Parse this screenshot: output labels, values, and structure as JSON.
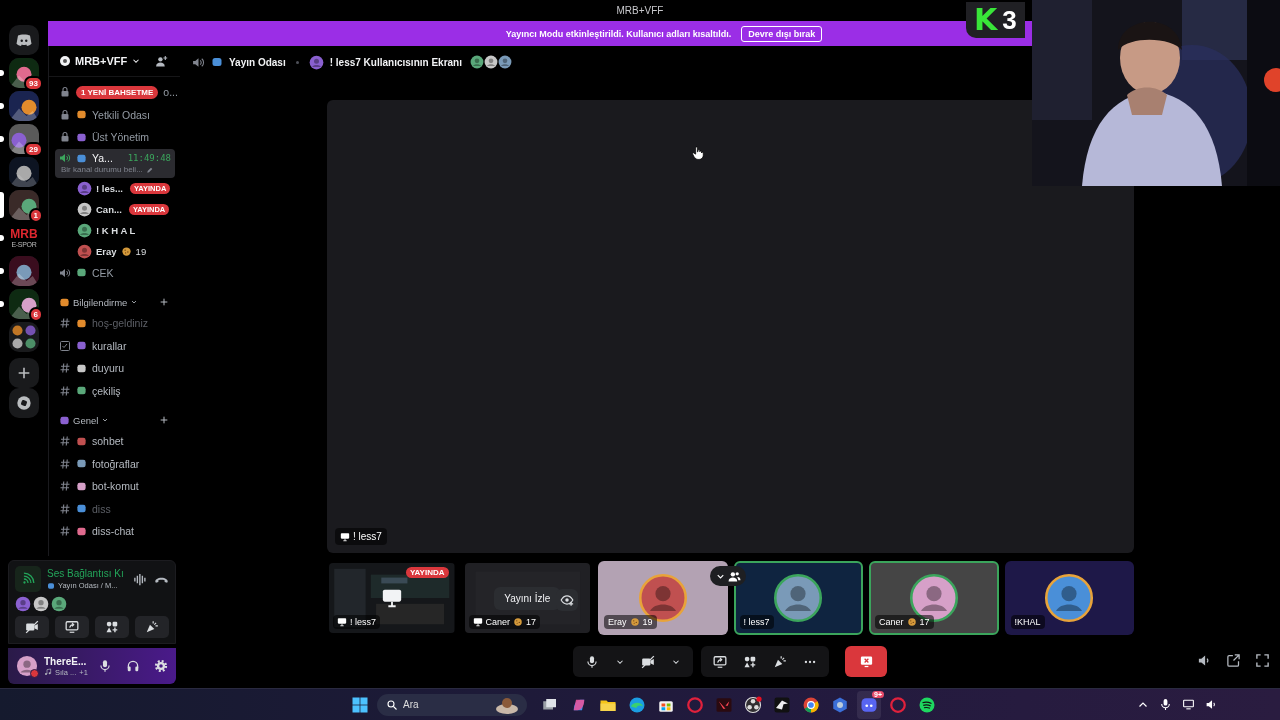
{
  "window": {
    "title": "MRB+VFF"
  },
  "banner": {
    "message": "Yayıncı Modu etkinleştirildi. Kullanıcı adları kısaltıldı.",
    "button": "Devre dışı bırak"
  },
  "stream_overlay": {
    "mark": "K",
    "score": "3"
  },
  "server_rail": [
    {
      "kind": "home",
      "unread": false,
      "selected": false
    },
    {
      "kind": "server",
      "badge": "93",
      "unread": true,
      "selected": false
    },
    {
      "kind": "server",
      "unread": true,
      "selected": false
    },
    {
      "kind": "server",
      "badge": "29",
      "unread": true,
      "selected": false
    },
    {
      "kind": "server",
      "unread": false,
      "selected": false
    },
    {
      "kind": "server",
      "badge": "1",
      "unread": false,
      "selected": true
    },
    {
      "kind": "text_logo",
      "text": "MRB",
      "subtext": "E-SPOR",
      "unread": true,
      "selected": false
    },
    {
      "kind": "server",
      "unread": true,
      "selected": false
    },
    {
      "kind": "server",
      "badge": "6",
      "unread": true,
      "selected": false
    },
    {
      "kind": "folder",
      "unread": false,
      "selected": false
    },
    {
      "kind": "add",
      "unread": false,
      "selected": false
    },
    {
      "kind": "discover",
      "unread": false,
      "selected": false
    }
  ],
  "sidebar": {
    "server_name": "MRB+VFF",
    "channels": [
      {
        "kind": "voice",
        "locked": true,
        "selected": false,
        "pill": "1 YENİ BAHSETME",
        "name": "o..."
      },
      {
        "kind": "voice",
        "locked": true,
        "selected": false,
        "name": "Yetkili Odası"
      },
      {
        "kind": "voice",
        "locked": true,
        "selected": false,
        "name": "Üst Yönetim"
      },
      {
        "kind": "voice",
        "locked": false,
        "selected": true,
        "name": "Ya...",
        "time": "11:49:48",
        "status": "Bir kanal durumu beli...",
        "members": [
          {
            "name": "! les...",
            "live": "YAYINDA"
          },
          {
            "name": "Can...",
            "live": "YAYINDA"
          },
          {
            "name": "! K H A L"
          },
          {
            "name": "Eray",
            "count": "19"
          }
        ]
      },
      {
        "kind": "voice",
        "locked": false,
        "selected": false,
        "name": "CEK"
      }
    ],
    "categories": [
      {
        "name": "Bilgilendirme",
        "expanded": true,
        "channels": [
          {
            "kind": "text",
            "name": "hoş-geldiniz",
            "muted": true
          },
          {
            "kind": "rules",
            "name": "kurallar",
            "muted": false
          },
          {
            "kind": "text",
            "name": "duyuru",
            "muted": false
          },
          {
            "kind": "text",
            "name": "çekiliş",
            "muted": false
          }
        ]
      },
      {
        "name": "Genel",
        "expanded": true,
        "channels": [
          {
            "kind": "text",
            "name": "sohbet",
            "muted": false
          },
          {
            "kind": "text",
            "name": "fotoğraflar",
            "muted": false
          },
          {
            "kind": "text",
            "name": "bot-komut",
            "muted": false
          },
          {
            "kind": "text",
            "name": "diss",
            "muted": true
          },
          {
            "kind": "text",
            "name": "diss-chat",
            "muted": false
          }
        ]
      }
    ]
  },
  "voice_panel": {
    "status": "Ses Bağlantısı Kı",
    "channel": "Yayın Odası / M..."
  },
  "user_panel": {
    "name": "ThereE...",
    "activity": "Sıla ...",
    "extra": "+1"
  },
  "header": {
    "channel": "Yayın Odası",
    "stream_title": "! less7 Kullanıcısının Ekranı"
  },
  "stage": {
    "label": "! less7",
    "participants_expanded": true
  },
  "tiles": [
    {
      "kind": "screen",
      "name": "! less7",
      "live": "YAYINDA",
      "speaking": false
    },
    {
      "kind": "watch",
      "name": "Caner",
      "count": "17",
      "button": "Yayını İzle",
      "speaking": false
    },
    {
      "kind": "avatar",
      "name": "Eray",
      "count": "19",
      "color": "#b3a2b3",
      "speaking": false
    },
    {
      "kind": "avatar",
      "name": "! less7",
      "color": "#0f2440",
      "speaking": true
    },
    {
      "kind": "avatar",
      "name": "Caner",
      "count": "17",
      "color": "#454545",
      "speaking": true
    },
    {
      "kind": "avatar",
      "name": "!KHAL",
      "color": "#1e1848",
      "speaking": false
    }
  ],
  "taskbar": {
    "search_placeholder": "Ara",
    "apps": [
      {
        "kind": "taskview",
        "selected": false
      },
      {
        "kind": "copilot",
        "selected": false
      },
      {
        "kind": "folder",
        "selected": false
      },
      {
        "kind": "edge",
        "selected": false
      },
      {
        "kind": "store",
        "selected": false
      },
      {
        "kind": "opera",
        "selected": false
      },
      {
        "kind": "valorant",
        "selected": false
      },
      {
        "kind": "obs",
        "selected": false
      },
      {
        "kind": "bird",
        "selected": false
      },
      {
        "kind": "chrome",
        "selected": false
      },
      {
        "kind": "gear",
        "selected": false
      },
      {
        "kind": "discord",
        "badge": "9+",
        "selected": true
      },
      {
        "kind": "opera",
        "selected": false
      },
      {
        "kind": "spotify",
        "selected": false
      }
    ]
  }
}
